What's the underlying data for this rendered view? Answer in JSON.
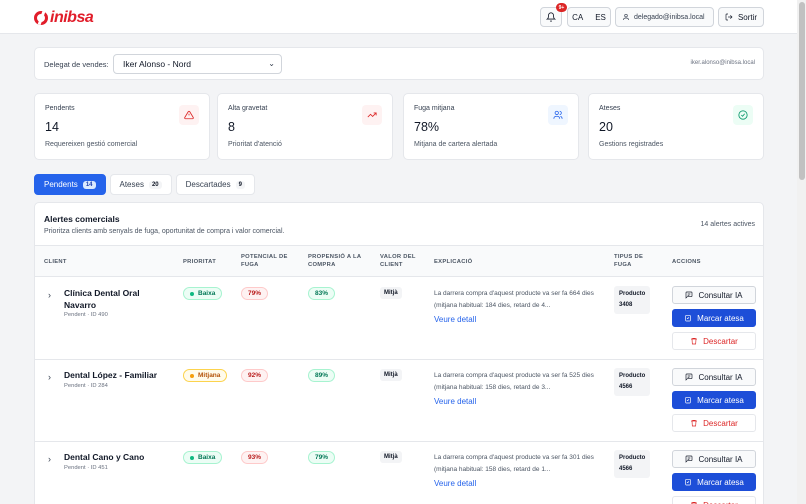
{
  "header": {
    "brand": "inibsa",
    "notifications_badge": "9+",
    "languages": [
      "CA",
      "ES"
    ],
    "user_email": "delegado@inibsa.local",
    "logout_label": "Sortir"
  },
  "delegate": {
    "label": "Delegat de vendes:",
    "selected": "Iker Alonso - Nord",
    "email": "iker.alonso@inibsa.local"
  },
  "cards": [
    {
      "title": "Pendents",
      "value": "14",
      "subtitle": "Requereixen gestió comercial",
      "icon": "warning-triangle-icon",
      "color": "#dc2626"
    },
    {
      "title": "Alta gravetat",
      "value": "8",
      "subtitle": "Prioritat d'atenció",
      "icon": "trending-up-icon",
      "color": "#dc2626"
    },
    {
      "title": "Fuga mitjana",
      "value": "78%",
      "subtitle": "Mitjana de cartera alertada",
      "icon": "users-icon",
      "color": "#2563eb"
    },
    {
      "title": "Ateses",
      "value": "20",
      "subtitle": "Gestions registrades",
      "icon": "check-circle-icon",
      "color": "#059669"
    }
  ],
  "tabs": [
    {
      "label": "Pendents",
      "count": "14"
    },
    {
      "label": "Ateses",
      "count": "20"
    },
    {
      "label": "Descartades",
      "count": "9"
    }
  ],
  "alerts": {
    "title": "Alertes comercials",
    "subtitle": "Prioritza clients amb senyals de fuga, oportunitat de compra i valor comercial.",
    "count_label": "14 alertes actives",
    "columns": {
      "client": "CLIENT",
      "prioritat": "PRIORITAT",
      "fuga": "POTENCIAL DE FUGA",
      "propensio": "PROPENSIÓ A LA COMPRA",
      "valor": "VALOR DEL CLIENT",
      "explicacio": "EXPLICACIÓ",
      "tipus": "TIPUS DE FUGA",
      "accions": "ACCIONS"
    },
    "rows": [
      {
        "name": "Clínica Dental Oral Navarro",
        "meta": "Pendent · ID 490",
        "priority": "Baixa",
        "fuga": "79%",
        "propensio": "83%",
        "valor": "Mitjà",
        "explanation": "La darrera compra d'aquest producte va ser fa 664 dies (mitjana habitual: 184 dies, retard de 4...",
        "link": "Veure detall",
        "tipus_l1": "Producto",
        "tipus_l2": "3408"
      },
      {
        "name": "Dental López - Familiar",
        "meta": "Pendent · ID 284",
        "priority": "Mitjana",
        "fuga": "92%",
        "propensio": "89%",
        "valor": "Mitjà",
        "explanation": "La darrera compra d'aquest producte va ser fa 525 dies (mitjana habitual: 158 dies, retard de 3...",
        "link": "Veure detall",
        "tipus_l1": "Producto",
        "tipus_l2": "4566"
      },
      {
        "name": "Dental Cano y Cano",
        "meta": "Pendent · ID 451",
        "priority": "Baixa",
        "fuga": "93%",
        "propensio": "79%",
        "valor": "Mitjà",
        "explanation": "La darrera compra d'aquest producte va ser fa 301 dies (mitjana habitual: 158 dies, retard de 1...",
        "link": "Veure detall",
        "tipus_l1": "Producto",
        "tipus_l2": "4566"
      }
    ],
    "actions": {
      "ia": "Consultar IA",
      "mark": "Marcar atesa",
      "discard": "Descartar"
    }
  }
}
